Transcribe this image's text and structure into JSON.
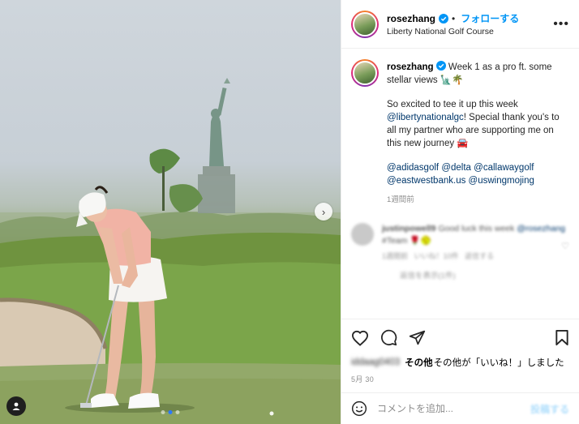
{
  "post": {
    "username": "rosezhang",
    "follow_label": "フォローする",
    "location": "Liberty National Golf Course",
    "more_icon": "more-horizontal-icon",
    "carousel": {
      "current_index": 1,
      "total": 3
    }
  },
  "caption": {
    "username": "rosezhang",
    "line1": "Week 1 as a pro ft. some stellar views 🗽🌴",
    "line2_prefix": "So excited to tee it up this week",
    "line2_mention": "@libertynationalgc",
    "line2_suffix": "! Special thank you's to all my partner who are supporting me on this new journey 🚘",
    "mentions": [
      "@adidasgolf",
      "@delta",
      "@callawaygolf",
      "@eastwestbank.us",
      "@uswingmojing"
    ],
    "time": "1週間前"
  },
  "comment_blurred": {
    "username": "justinpowell9",
    "text_a": "Good luck this week",
    "mention": "@rosezhang",
    "text_b": "#Team 🌹🥎",
    "meta_a": "1週間前",
    "meta_b": "いいね！10件",
    "meta_c": "返信する",
    "replies": "返信を表示(1件)"
  },
  "likes": {
    "blurred_user": "iddaag0403",
    "suffix": "その他が「いいね！」しました",
    "others_label": "その他"
  },
  "date": "5月 30",
  "comment_input": {
    "placeholder": "コメントを追加...",
    "post_label": "投稿する"
  },
  "colors": {
    "accent": "#0095f6",
    "mention": "#00376b",
    "muted": "#8e8e8e",
    "carousel_dot_active": "#2b79ff"
  }
}
